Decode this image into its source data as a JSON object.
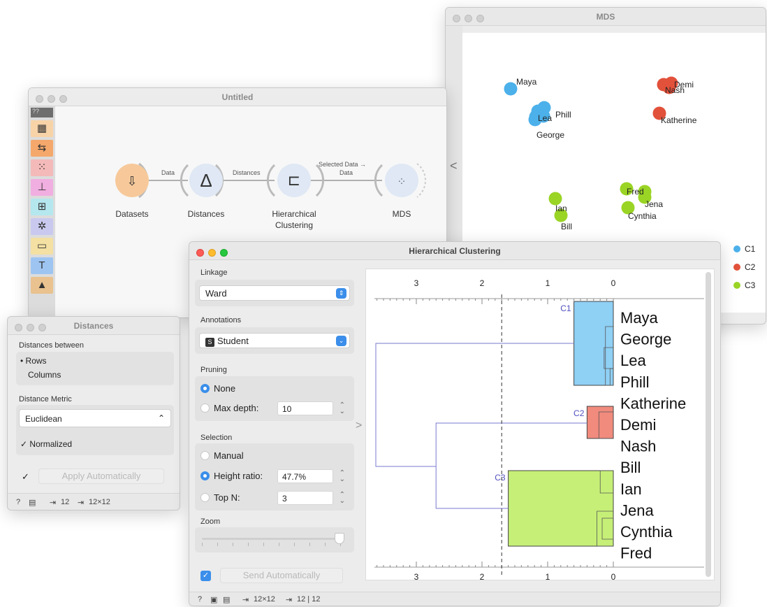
{
  "canvas_window": {
    "title": "Untitled",
    "toolbar_badge": "??",
    "nodes": [
      {
        "name": "Datasets",
        "line2": ""
      },
      {
        "name": "Distances",
        "line2": ""
      },
      {
        "name": "Hierarchical",
        "line2": "Clustering"
      },
      {
        "name": "MDS",
        "line2": ""
      }
    ],
    "links": [
      {
        "label": "Data",
        "label2": ""
      },
      {
        "label": "Distances",
        "label2": ""
      },
      {
        "label": "Selected Data →",
        "label2": "Data"
      }
    ]
  },
  "mds_window": {
    "title": "MDS",
    "points": [
      {
        "label": "Maya",
        "cluster": "C1"
      },
      {
        "label": "Phill",
        "cluster": "C1"
      },
      {
        "label": "Lea",
        "cluster": "C1"
      },
      {
        "label": "George",
        "cluster": "C1"
      },
      {
        "label": "Demi",
        "cluster": "C2"
      },
      {
        "label": "Nash",
        "cluster": "C2"
      },
      {
        "label": "Katherine",
        "cluster": "C2"
      },
      {
        "label": "Fred",
        "cluster": "C3"
      },
      {
        "label": "Jena",
        "cluster": "C3"
      },
      {
        "label": "Cynthia",
        "cluster": "C3"
      },
      {
        "label": "Ian",
        "cluster": "C3"
      },
      {
        "label": "Bill",
        "cluster": "C3"
      }
    ],
    "legend": [
      {
        "label": "C1",
        "color": "#4cb0ea"
      },
      {
        "label": "C2",
        "color": "#e2513a"
      },
      {
        "label": "C3",
        "color": "#9ad425"
      }
    ],
    "collapse_glyph": "<"
  },
  "distances_window": {
    "title": "Distances",
    "distances_between_label": "Distances between",
    "rows_label": "Rows",
    "columns_label": "Columns",
    "metric_label": "Distance Metric",
    "metric_value": "Euclidean",
    "normalized_label": "Normalized",
    "apply_label": "Apply Automatically",
    "status_in": "12",
    "status_out": "12×12"
  },
  "hc_window": {
    "title": "Hierarchical Clustering",
    "linkage_label": "Linkage",
    "linkage_value": "Ward",
    "annotations_label": "Annotations",
    "annotations_badge": "S",
    "annotations_value": "Student",
    "pruning_label": "Pruning",
    "pruning_none": "None",
    "pruning_maxdepth": "Max depth:",
    "pruning_maxdepth_value": "10",
    "selection_label": "Selection",
    "selection_manual": "Manual",
    "selection_height": "Height ratio:",
    "selection_height_value": "47.7%",
    "selection_topn": "Top N:",
    "selection_topn_value": "3",
    "zoom_label": "Zoom",
    "send_label": "Send Automatically",
    "status_in": "12×12",
    "status_out": "12 | 12",
    "expand_glyph": ">",
    "axis_ticks": [
      "3",
      "2",
      "1",
      "0"
    ],
    "leaves": [
      "Maya",
      "George",
      "Lea",
      "Phill",
      "Katherine",
      "Demi",
      "Nash",
      "Bill",
      "Ian",
      "Jena",
      "Cynthia",
      "Fred"
    ],
    "clusters": [
      {
        "label": "C1",
        "color": "#8fd0f5"
      },
      {
        "label": "C2",
        "color": "#f08b7d"
      },
      {
        "label": "C3",
        "color": "#c6ef77"
      }
    ]
  }
}
